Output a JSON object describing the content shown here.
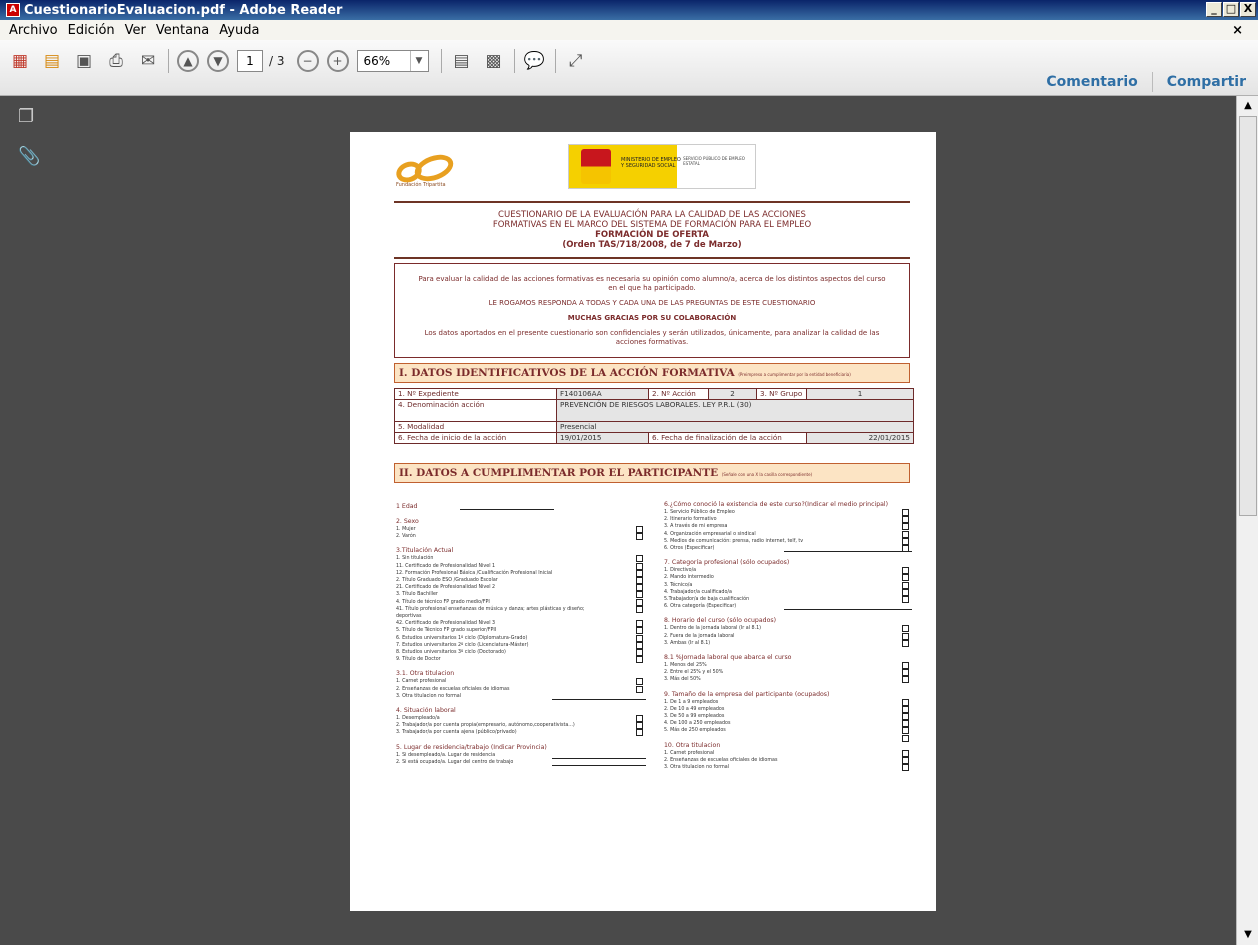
{
  "window": {
    "title": "CuestionarioEvaluacion.pdf - Adobe Reader",
    "controls": [
      "_",
      "□",
      "X"
    ]
  },
  "menu": [
    "Archivo",
    "Edición",
    "Ver",
    "Ventana",
    "Ayuda"
  ],
  "toolbar": {
    "page_current": "1",
    "page_total": "/ 3",
    "zoom": "66%",
    "comment_label": "Comentario",
    "share_label": "Compartir"
  },
  "doc": {
    "logo_caption": "Fundación Tripartita",
    "ministry_text": "MINISTERIO DE EMPLEO Y SEGURIDAD SOCIAL",
    "service_text": "SERVICIO PÚBLICO DE EMPLEO ESTATAL",
    "title1": "CUESTIONARIO DE LA EVALUACIÓN PARA LA CALIDAD DE LAS ACCIONES",
    "title2": "FORMATIVAS EN EL MARCO DEL SISTEMA DE FORMACIÓN PARA EL EMPLEO",
    "title3": "FORMACIÓN DE OFERTA",
    "title4": "(Orden TAS/718/2008, de 7 de Marzo)",
    "intro1": "Para evaluar la calidad de las acciones formativas es necesaria su opinión como alumno/a, acerca de los distintos aspectos del curso en el que ha participado.",
    "intro2": "LE ROGAMOS RESPONDA A TODAS Y CADA UNA DE LAS PREGUNTAS DE ESTE CUESTIONARIO",
    "intro3": "MUCHAS GRACIAS POR SU COLABORACIÓN",
    "intro4": "Los datos aportados en el presente cuestionario son confidenciales y serán utilizados, únicamente, para analizar la calidad de las acciones formativas.",
    "sec1": "I. DATOS IDENTIFICATIVOS DE LA ACCIÓN FORMATIVA",
    "sec1_note": "(Preimpreso a cumplimentar por la entidad beneficiaria)",
    "sec2": "II. DATOS A CUMPLIMENTAR POR EL PARTICIPANTE",
    "sec2_note": "(Señale con una X la casilla correspondiente)",
    "table": {
      "expediente_label": "1. Nº Expediente",
      "expediente": "F140106AA",
      "accion_label": "2. Nº Acción",
      "accion": "2",
      "grupo_label": "3. Nº Grupo",
      "grupo": "1",
      "denominacion_label": "4. Denominación acción",
      "denominacion": "PREVENCIÓN DE RIESGOS LABORALES. LEY P.R.L (30)",
      "modalidad_label": "5. Modalidad",
      "modalidad": "Presencial",
      "inicio_label": "6. Fecha de inicio de la acción",
      "inicio": "19/01/2015",
      "fin_label": "6. Fecha de finalización de la acción",
      "fin": "22/01/2015"
    },
    "left": [
      {
        "h": "1 Edad",
        "line": true
      },
      {
        "h": "2. Sexo"
      },
      {
        "t": "1. Mujer",
        "cb": true
      },
      {
        "t": "2. Varón",
        "cb": true
      },
      {
        "h": "3.Titulación Actual"
      },
      {
        "t": "1. Sin titulación",
        "cb": true
      },
      {
        "t": "11. Certificado de Profesionalidad Nivel 1",
        "cb": true
      },
      {
        "t": "12. Formación Profesional Básica /Cualificación Profesional Inicial",
        "cb": true
      },
      {
        "t": "2. Título Graduado ESO /Graduado Escolar",
        "cb": true
      },
      {
        "t": "21. Certificado de Profesionalidad Nivel 2",
        "cb": true
      },
      {
        "t": "3. Título Bachiller",
        "cb": true
      },
      {
        "t": "4. Título de técnico FP grado medio/FPI",
        "cb": true
      },
      {
        "t": "41. Título profesional enseñanzas de música y danza; artes plásticas y diseño;",
        "cb": true
      },
      {
        "t": "    deportivas"
      },
      {
        "t": "42. Certificado de Profesionalidad Nivel 3",
        "cb": true
      },
      {
        "t": "5. Título de Técnico FP grado superior/FPII",
        "cb": true
      },
      {
        "t": "6. Estudios universitarios 1º ciclo (Diplomatura-Grado)",
        "cb": true
      },
      {
        "t": "7. Estudios universitarios 2º ciclo (Licenciatura-Máster)",
        "cb": true
      },
      {
        "t": "8. Estudios universitarios 3º ciclo (Doctorado)",
        "cb": true
      },
      {
        "t": "9. Título de Doctor",
        "cb": true
      },
      {
        "h": "3.1. Otra titulacion"
      },
      {
        "t": "1. Carnet profesional",
        "cb": true
      },
      {
        "t": "2. Enseñanzas de escuelas oficiales de idiomas",
        "cb": true
      },
      {
        "t": "3. Otra titulacion no formal",
        "line": true
      },
      {
        "h": "4. Situación laboral"
      },
      {
        "t": "1. Desempleado/a",
        "cb": true
      },
      {
        "t": "2. Trabajador/a por cuenta propia(empresario, autónomo,cooperativista...)",
        "cb": true
      },
      {
        "t": "3. Trabajador/a por cuenta ajena (público/privado)",
        "cb": true
      },
      {
        "h": "5. Lugar de residencia/trabajo (Indicar Provincia)"
      },
      {
        "t": "1. Si desempleado/a. Lugar de residencia",
        "line": true
      },
      {
        "t": "2. Si está ocupado/a. Lugar del centro de trabajo",
        "line": true
      }
    ],
    "right": [
      {
        "h": "6.¿Cómo conoció la existencia de este curso?(Indicar el medio principal)"
      },
      {
        "t": "1. Servicio Público de Empleo",
        "cb": true
      },
      {
        "t": "2. Itinerario formativo",
        "cb": true
      },
      {
        "t": "3. A través de mi empresa",
        "cb": true
      },
      {
        "t": "4. Organización empresarial o sindical",
        "cb": true
      },
      {
        "t": "5. Medios de comunicación: prensa, radio internet, telf, tv",
        "cb": true
      },
      {
        "t": "6. Otros (Especificar)",
        "cb": true,
        "line": true
      },
      {
        "h": "7. Categoría profesional (sólo ocupados)"
      },
      {
        "t": "1. Directivo/a",
        "cb": true
      },
      {
        "t": "2. Mando intermedio",
        "cb": true
      },
      {
        "t": "3. Técnico/a",
        "cb": true
      },
      {
        "t": "4. Trabajador/a cualificado/a",
        "cb": true
      },
      {
        "t": "5.Trabajador/a de baja cualificación",
        "cb": true
      },
      {
        "t": "6. Otra categoría (Especificar)",
        "line": true
      },
      {
        "h": "8. Horario del curso (sólo ocupados)"
      },
      {
        "t": "1. Dentro de la jornada laboral (Ir al 8.1)",
        "cb": true
      },
      {
        "t": "2. Fuera de la jornada laboral",
        "cb": true
      },
      {
        "t": "3. Ambas (Ir al 8.1)",
        "cb": true
      },
      {
        "h": "8.1  %Jornada laboral que abarca el curso"
      },
      {
        "t": "1. Menos del 25%",
        "cb": true
      },
      {
        "t": "2. Entre el 25% y el 50%",
        "cb": true
      },
      {
        "t": "3. Más del 50%",
        "cb": true
      },
      {
        "h": "9. Tamaño de la empresa del participante (ocupados)"
      },
      {
        "t": "1. De 1 a 9 empleados",
        "cb": true
      },
      {
        "t": "2. De 10 a 49 empleados",
        "cb": true
      },
      {
        "t": "3. De 50 a 99 empleados",
        "cb": true
      },
      {
        "t": "4. De 100 a 250 empleados",
        "cb": true
      },
      {
        "t": "5. Más de 250 empleados",
        "cb": true
      },
      {
        "t": "",
        "cb": true
      },
      {
        "h": "10. Otra titulacion"
      },
      {
        "t": "1. Carnet profesional",
        "cb": true
      },
      {
        "t": "2. Enseñanzas de escuelas oficiales de idiomas",
        "cb": true
      },
      {
        "t": "3. Otra titulacion no formal",
        "cb": true
      }
    ]
  }
}
